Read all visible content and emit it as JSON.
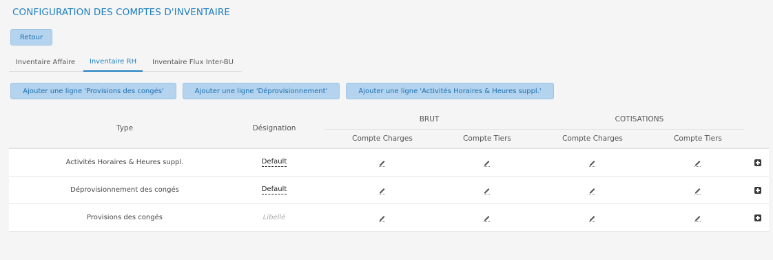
{
  "page": {
    "title": "CONFIGURATION DES COMPTES D'INVENTAIRE",
    "back_label": "Retour"
  },
  "tabs": [
    {
      "label": "Inventaire Affaire",
      "active": false
    },
    {
      "label": "Inventaire RH",
      "active": true
    },
    {
      "label": "Inventaire Flux Inter-BU",
      "active": false
    }
  ],
  "actions": [
    {
      "label": "Ajouter une ligne 'Provisions des congés'"
    },
    {
      "label": "Ajouter une ligne 'Déprovisionnement'"
    },
    {
      "label": "Ajouter une ligne 'Activités Horaires & Heures suppl.'"
    }
  ],
  "table": {
    "headers": {
      "type": "Type",
      "designation": "Désignation",
      "brut": "BRUT",
      "cotisations": "COTISATIONS",
      "brut_charges": "Compte Charges",
      "brut_tiers": "Compte Tiers",
      "cot_charges": "Compte Charges",
      "cot_tiers": "Compte Tiers"
    },
    "rows": [
      {
        "type": "Activités Horaires & Heures suppl.",
        "designation": "Default",
        "placeholder": false
      },
      {
        "type": "Déprovisionnement des congés",
        "designation": "Default",
        "placeholder": false
      },
      {
        "type": "Provisions des congés",
        "designation": "Libellé",
        "placeholder": true
      }
    ]
  },
  "icons": {
    "edit": "pencil-icon",
    "add": "plus-square-icon"
  },
  "colors": {
    "accent": "#1e7fc0",
    "button_bg": "#b4d3ee",
    "page_bg": "#f5f5f5"
  }
}
